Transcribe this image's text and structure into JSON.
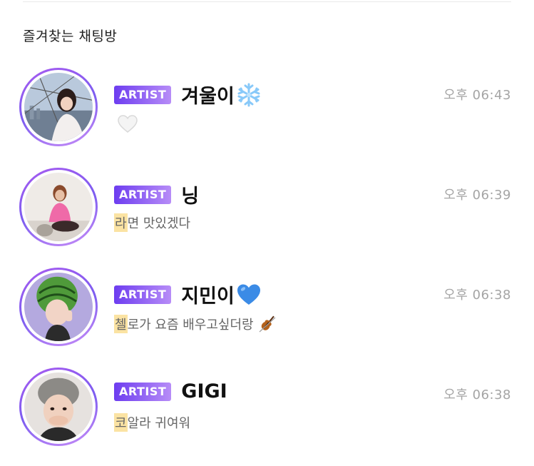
{
  "section": {
    "title": "즐겨찾는 채팅방"
  },
  "chats": [
    {
      "badge": "ARTIST",
      "name": "겨울이",
      "name_emoji": "snowflake-icon",
      "time": "오후 06:43",
      "preview_highlight": "",
      "preview_rest": "",
      "preview_emoji": "white-heart-icon"
    },
    {
      "badge": "ARTIST",
      "name": "닝",
      "name_emoji": "",
      "time": "오후 06:39",
      "preview_highlight": "라",
      "preview_rest": "면 맛있겠다",
      "preview_emoji": ""
    },
    {
      "badge": "ARTIST",
      "name": "지민이",
      "name_emoji": "blue-heart-icon",
      "time": "오후 06:38",
      "preview_highlight": "첼",
      "preview_rest": "로가 요즘 배우고싶더랑",
      "preview_emoji": "violin-icon"
    },
    {
      "badge": "ARTIST",
      "name": "GIGI",
      "name_emoji": "",
      "time": "오후 06:38",
      "preview_highlight": "코",
      "preview_rest": "알라 귀여워",
      "preview_emoji": ""
    }
  ]
}
